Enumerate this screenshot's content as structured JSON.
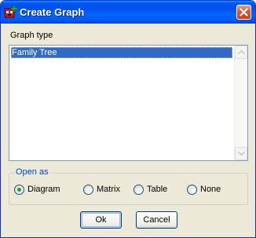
{
  "window": {
    "title": "Create Graph"
  },
  "graph_type": {
    "label": "Graph type",
    "items": [
      "Family Tree"
    ],
    "selected": "Family Tree"
  },
  "open_as": {
    "legend": "Open as",
    "options": [
      "Diagram",
      "Matrix",
      "Table",
      "None"
    ],
    "selected": "Diagram"
  },
  "buttons": {
    "ok": "Ok",
    "cancel": "Cancel"
  },
  "icons": {
    "app": "app-graph-icon",
    "close": "close-icon",
    "scroll_up": "arrow-up-icon",
    "scroll_down": "arrow-down-icon"
  },
  "colors": {
    "titlebar": "#0058ee",
    "selection": "#316ac5",
    "legend_text": "#0046d5",
    "radio_dot": "#21a121"
  }
}
